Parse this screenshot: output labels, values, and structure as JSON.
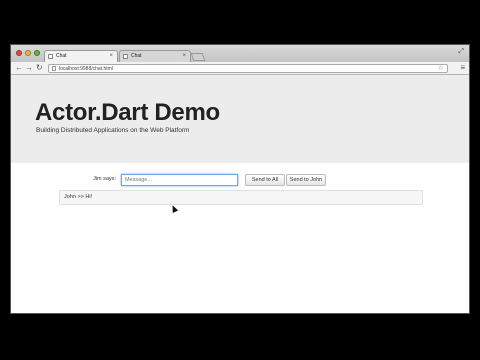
{
  "browser": {
    "tabs": [
      {
        "title": "Chat",
        "active": true
      },
      {
        "title": "Chat",
        "active": false
      }
    ],
    "url": "localhost:9988/chat.html"
  },
  "hero": {
    "title": "Actor.Dart Demo",
    "subtitle": "Building Distributed Applications on the Web Platform"
  },
  "chat": {
    "sender_label": "Jim says:",
    "message_placeholder": "Message...",
    "send_all_label": "Send to All",
    "send_john_label": "Send to John",
    "messages": [
      "John >> Hi!"
    ]
  },
  "colors": {
    "hero_bg": "#ececec",
    "input_focus": "#6aa9e9"
  }
}
